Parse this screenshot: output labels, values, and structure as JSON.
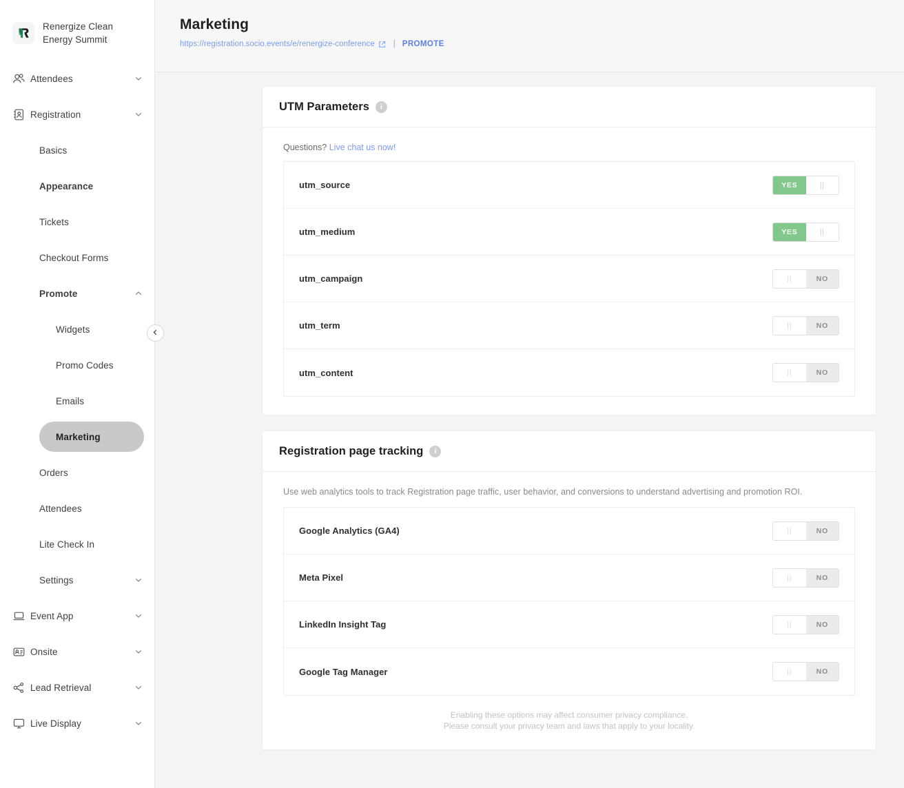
{
  "brand": {
    "name": "Renergize Clean Energy Summit",
    "logo_icon": "r-monogram-logo"
  },
  "sidebar": {
    "collapse_icon": "chevron-left-icon",
    "items": [
      {
        "label": "Attendees",
        "icon": "people-icon",
        "level": 1,
        "expandable": true,
        "expanded": false,
        "active": false
      },
      {
        "label": "Registration",
        "icon": "contact-card-icon",
        "level": 1,
        "expandable": true,
        "expanded": false,
        "active": false
      },
      {
        "label": "Basics",
        "level": 2,
        "expandable": false,
        "active": false
      },
      {
        "label": "Appearance",
        "level": 2,
        "expandable": false,
        "active": false,
        "bold": true
      },
      {
        "label": "Tickets",
        "level": 2,
        "expandable": false,
        "active": false
      },
      {
        "label": "Checkout Forms",
        "level": 2,
        "expandable": false,
        "active": false
      },
      {
        "label": "Promote",
        "level": 2,
        "expandable": true,
        "expanded": true,
        "active": false,
        "bold": true
      },
      {
        "label": "Widgets",
        "level": 3,
        "expandable": false,
        "active": false
      },
      {
        "label": "Promo Codes",
        "level": 3,
        "expandable": false,
        "active": false
      },
      {
        "label": "Emails",
        "level": 3,
        "expandable": false,
        "active": false
      },
      {
        "label": "Marketing",
        "level": 3,
        "expandable": false,
        "active": true
      },
      {
        "label": "Orders",
        "level": 2,
        "expandable": false,
        "active": false
      },
      {
        "label": "Attendees",
        "level": 2,
        "expandable": false,
        "active": false
      },
      {
        "label": "Lite Check In",
        "level": 2,
        "expandable": false,
        "active": false
      },
      {
        "label": "Settings",
        "level": 2,
        "expandable": true,
        "expanded": false,
        "active": false
      },
      {
        "label": "Event App",
        "icon": "laptop-icon",
        "level": 1,
        "expandable": true,
        "expanded": false,
        "active": false
      },
      {
        "label": "Onsite",
        "icon": "badge-icon",
        "level": 1,
        "expandable": true,
        "expanded": false,
        "active": false
      },
      {
        "label": "Lead Retrieval",
        "icon": "share-icon",
        "level": 1,
        "expandable": true,
        "expanded": false,
        "active": false
      },
      {
        "label": "Live Display",
        "icon": "monitor-icon",
        "level": 1,
        "expandable": true,
        "expanded": false,
        "active": false
      }
    ]
  },
  "header": {
    "title": "Marketing",
    "url": "https://registration.socio.events/e/renergize-conference",
    "external_link_icon": "external-link-icon",
    "separator": "|",
    "promote_label": "PROMOTE"
  },
  "utm_card": {
    "title": "UTM Parameters",
    "info_icon": "info-icon",
    "questions_prefix": "Questions?",
    "questions_link": "Live chat us now!",
    "rows": [
      {
        "label": "utm_source",
        "state": "YES",
        "on": true
      },
      {
        "label": "utm_medium",
        "state": "YES",
        "on": true
      },
      {
        "label": "utm_campaign",
        "state": "NO",
        "on": false
      },
      {
        "label": "utm_term",
        "state": "NO",
        "on": false
      },
      {
        "label": "utm_content",
        "state": "NO",
        "on": false
      }
    ]
  },
  "tracking_card": {
    "title": "Registration page tracking",
    "info_icon": "info-icon",
    "description": "Use web analytics tools to track Registration page traffic, user behavior, and conversions to understand advertising and promotion ROI.",
    "rows": [
      {
        "label": "Google Analytics (GA4)",
        "state": "NO",
        "on": false
      },
      {
        "label": "Meta Pixel",
        "state": "NO",
        "on": false
      },
      {
        "label": "LinkedIn Insight Tag",
        "state": "NO",
        "on": false
      },
      {
        "label": "Google Tag Manager",
        "state": "NO",
        "on": false
      }
    ],
    "disclaimer_line1": "Enabling these options may affect consumer privacy compliance.",
    "disclaimer_line2": "Please consult your privacy team and laws that apply to your locality."
  },
  "colors": {
    "toggle_on": "#82c88a",
    "link": "#7c9cf5",
    "promote": "#5b7fe8",
    "active_pill": "#c9c9c9",
    "page_bg": "#f4f4f4"
  }
}
